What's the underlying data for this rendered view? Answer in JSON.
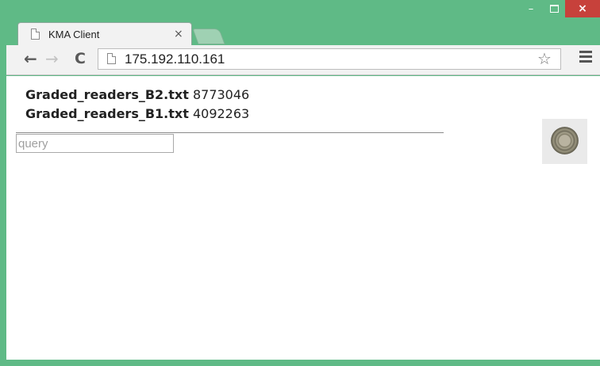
{
  "window": {
    "caption_buttons": {
      "minimize": "–",
      "close": "×"
    },
    "colors": {
      "frame": "#5fba86",
      "close": "#c7413b"
    }
  },
  "tab": {
    "title": "KMA Client",
    "close_glyph": "×"
  },
  "toolbar": {
    "back_glyph": "←",
    "forward_glyph": "→",
    "reload_glyph": "C",
    "url": "175.192.110.161",
    "star_glyph": "☆",
    "icons": [
      "back-arrow-icon",
      "forward-arrow-icon",
      "reload-icon",
      "page-icon",
      "star-icon",
      "menu-icon"
    ]
  },
  "content": {
    "files": [
      {
        "name": "Graded_readers_B2.txt",
        "size": "8773046"
      },
      {
        "name": "Graded_readers_B1.txt",
        "size": "4092263"
      }
    ],
    "query": {
      "value": "",
      "placeholder": "query"
    },
    "logo": "seal-logo"
  }
}
